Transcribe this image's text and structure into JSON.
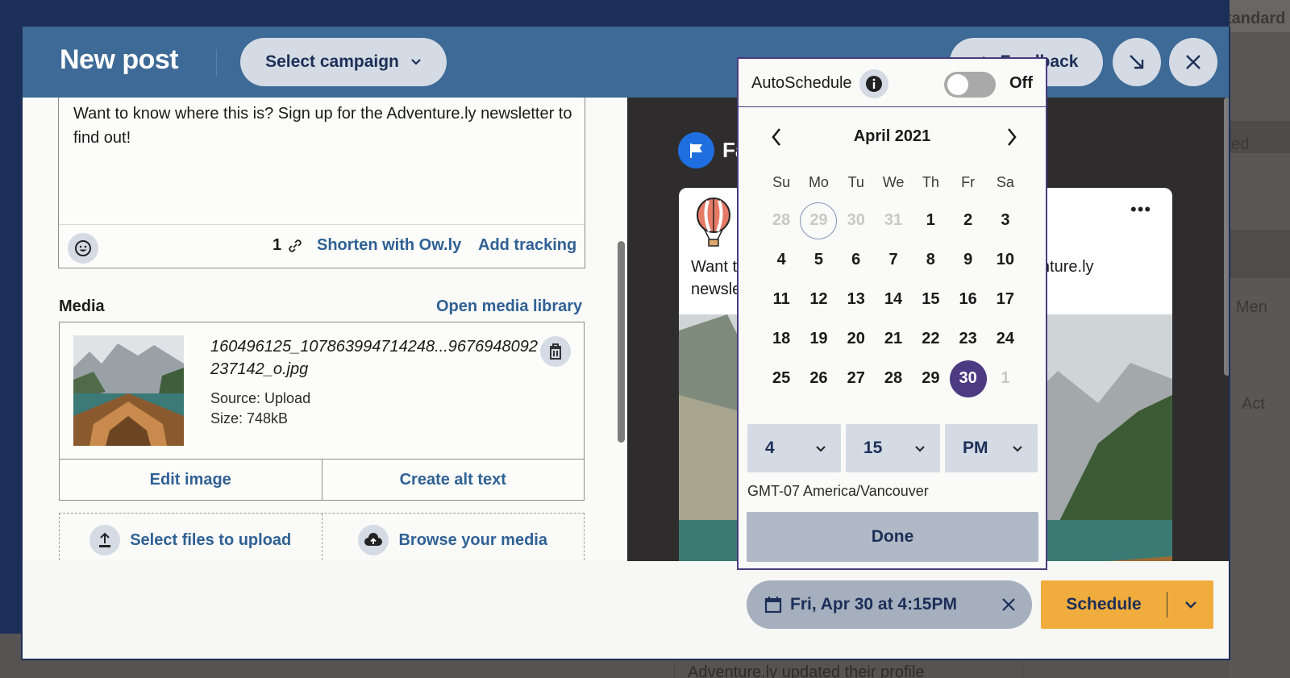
{
  "background": {
    "right_texts": [
      "tandard",
      "ed",
      "Men",
      "Act"
    ],
    "bottom_text": "Adventure.ly updated their profile"
  },
  "header": {
    "title": "New post",
    "campaign_label": "Select campaign",
    "feedback_label": "Feedback"
  },
  "composer": {
    "text": "Want to know where this is? Sign up for the Adventure.ly newsletter to find out!",
    "link_count": "1",
    "shorten_label": "Shorten with Ow.ly",
    "tracking_label": "Add tracking"
  },
  "media": {
    "label": "Media",
    "open_library_label": "Open media library",
    "file_name": "160496125_107863994714248...9676948092237142_o.jpg",
    "source": "Source: Upload",
    "size": "Size: 748kB",
    "edit_label": "Edit image",
    "alt_text_label": "Create alt text",
    "select_files_label": "Select files to upload",
    "browse_label": "Browse your media"
  },
  "preview": {
    "network_name": "Fa",
    "post_text_visible": "Want to know where this is? Sign up for the Adventure.ly newsletter to find out!",
    "post_link_text": "Adventure.ly"
  },
  "scheduler": {
    "autoschedule_label": "AutoSchedule",
    "toggle_state": "Off",
    "month_title": "April 2021",
    "weekdays": [
      "Su",
      "Mo",
      "Tu",
      "We",
      "Th",
      "Fr",
      "Sa"
    ],
    "days": [
      {
        "d": "28",
        "muted": true
      },
      {
        "d": "29",
        "muted": true,
        "today": true
      },
      {
        "d": "30",
        "muted": true
      },
      {
        "d": "31",
        "muted": true
      },
      {
        "d": "1"
      },
      {
        "d": "2"
      },
      {
        "d": "3"
      },
      {
        "d": "4"
      },
      {
        "d": "5"
      },
      {
        "d": "6"
      },
      {
        "d": "7"
      },
      {
        "d": "8"
      },
      {
        "d": "9"
      },
      {
        "d": "10"
      },
      {
        "d": "11"
      },
      {
        "d": "12"
      },
      {
        "d": "13"
      },
      {
        "d": "14"
      },
      {
        "d": "15"
      },
      {
        "d": "16"
      },
      {
        "d": "17"
      },
      {
        "d": "18"
      },
      {
        "d": "19"
      },
      {
        "d": "20"
      },
      {
        "d": "21"
      },
      {
        "d": "22"
      },
      {
        "d": "23"
      },
      {
        "d": "24"
      },
      {
        "d": "25"
      },
      {
        "d": "26"
      },
      {
        "d": "27"
      },
      {
        "d": "28"
      },
      {
        "d": "29"
      },
      {
        "d": "30",
        "selected": true
      },
      {
        "d": "1",
        "muted": true
      }
    ],
    "hour": "4",
    "minute": "15",
    "meridiem": "PM",
    "timezone": "GMT-07 America/Vancouver",
    "done_label": "Done"
  },
  "footer": {
    "scheduled_date": "Fri, Apr 30 at 4:15PM",
    "schedule_label": "Schedule"
  },
  "colors": {
    "header_bg": "#3d6a96",
    "link": "#2f6194",
    "selected_day": "#4c3a82",
    "schedule_button": "#f1ac3e",
    "navy_text": "#1c2f58"
  }
}
